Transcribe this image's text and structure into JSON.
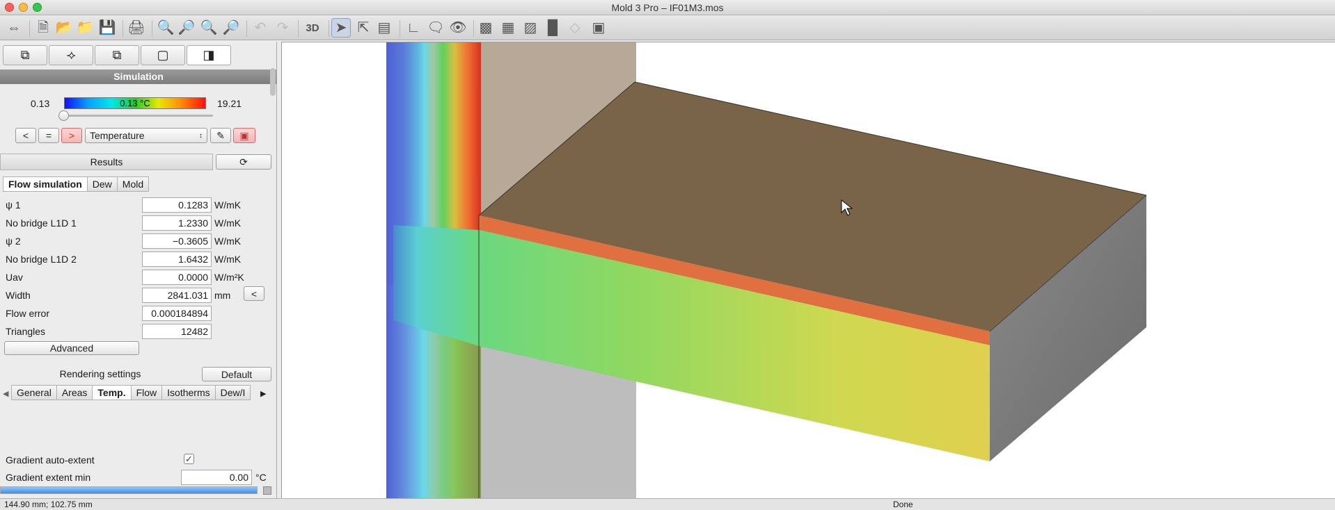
{
  "window": {
    "title": "Mold 3 Pro – IF01M3.mos"
  },
  "toolbar": {
    "icons": [
      "link-icon",
      "new-file-icon",
      "open-folder-icon",
      "open-recent-icon",
      "save-icon",
      "print-icon",
      "zoom-in-icon",
      "zoom-out-icon",
      "zoom-fit-icon",
      "zoom-reset-icon",
      "undo-icon",
      "redo-icon",
      "3d-toggle",
      "select-icon",
      "select-area-icon",
      "measure-icon",
      "dimension-icon",
      "comment-icon",
      "visibility-icon",
      "layer-1-icon",
      "layer-2-icon",
      "layer-3-icon",
      "histogram-icon",
      "disabled-icon",
      "color-icon"
    ],
    "view_3d_label": "3D"
  },
  "leftpanel": {
    "simulation_header": "Simulation",
    "gradient": {
      "min": "0.13",
      "max": "19.21",
      "current": "0.13 °C",
      "slider_fraction": 0.0
    },
    "nav": {
      "prev": "<",
      "equal": "=",
      "next": ">"
    },
    "mode_select": {
      "value": "Temperature"
    },
    "results_header": "Results",
    "result_tabs": [
      "Flow simulation",
      "Dew",
      "Mold"
    ],
    "results": [
      {
        "label": "ψ 1",
        "value": "0.1283",
        "unit": "W/mK"
      },
      {
        "label": "No bridge L1D 1",
        "value": "1.2330",
        "unit": "W/mK"
      },
      {
        "label": "ψ 2",
        "value": "−0.3605",
        "unit": "W/mK"
      },
      {
        "label": "No bridge L1D 2",
        "value": "1.6432",
        "unit": "W/mK"
      },
      {
        "label": "Uav",
        "value": "0.0000",
        "unit": "W/m²K"
      },
      {
        "label": "Width",
        "value": "2841.031",
        "unit": "mm"
      },
      {
        "label": "Flow error",
        "value": "0.000184894",
        "unit": ""
      },
      {
        "label": "Triangles",
        "value": "12482",
        "unit": ""
      }
    ],
    "width_button": "<",
    "advanced_button": "Advanced",
    "rendering_header": "Rendering settings",
    "default_button": "Default",
    "render_tabs": [
      "General",
      "Areas",
      "Temp.",
      "Flow",
      "Isotherms",
      "Dew/I"
    ],
    "render_selected": "Temp.",
    "gradient_auto_extent_label": "Gradient auto-extent",
    "gradient_auto_extent": true,
    "gradient_extent_min_label": "Gradient extent min",
    "gradient_extent_min_value": "0.00",
    "gradient_extent_min_unit": "°C",
    "progress_fraction": 1.0
  },
  "status": {
    "coords": "144.90 mm; 102.75 mm",
    "message": "Done"
  },
  "colors": {
    "accent": "#c9d4e4",
    "red_button": "#f7b3b3",
    "gradient_start": "#0000ff",
    "gradient_end": "#ff0000"
  }
}
